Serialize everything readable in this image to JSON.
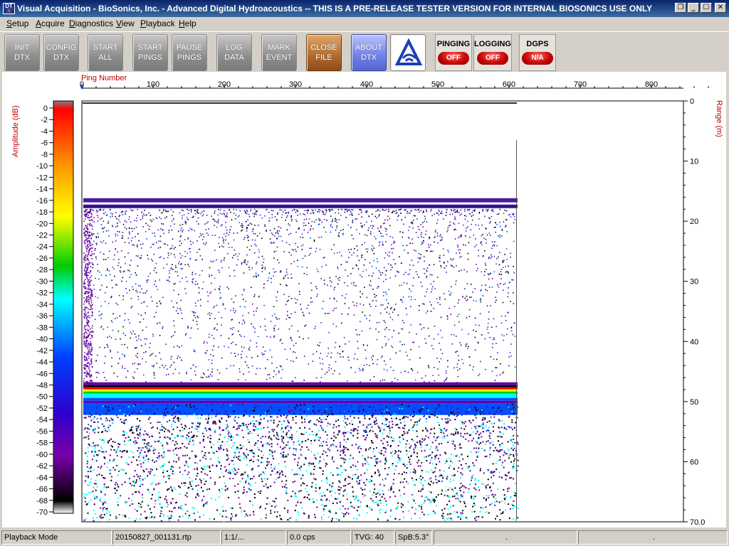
{
  "window": {
    "title": "Visual Acquisition  -  BioSonics, Inc.  -  Advanced Digital Hydroacoustics  -- THIS IS A PRE-RELEASE TESTER VERSION FOR INTERNAL BIOSONICS USE ONLY",
    "icon_top": "DT",
    "icon_bottom": "X",
    "restore_glyph": "❐",
    "minimize_glyph": "_",
    "maximize_glyph": "☐",
    "close_glyph": "✕"
  },
  "menu": {
    "items": [
      {
        "accel": "S",
        "rest": "etup"
      },
      {
        "accel": "A",
        "rest": "cquire"
      },
      {
        "accel": "D",
        "rest": "iagnostics"
      },
      {
        "accel": "V",
        "rest": "iew"
      },
      {
        "accel": "P",
        "rest": "layback"
      },
      {
        "accel": "H",
        "rest": "elp"
      }
    ]
  },
  "toolbar": {
    "init": "INIT\nDTX",
    "config": "CONFIG\nDTX",
    "start_all": "START\nALL",
    "start_pings": "START\nPINGS",
    "pause_pings": "PAUSE\nPINGS",
    "log_data": "LOG\nDATA",
    "mark_event": "MARK\nEVENT",
    "close_file": "CLOSE\nFILE",
    "about": "ABOUT\nDTX",
    "logo_icon": "biosonics-logo-icon",
    "pinging_label": "PINGING",
    "pinging_state": "OFF",
    "logging_label": "LOGGING",
    "logging_state": "OFF",
    "dgps_label": "DGPS",
    "dgps_state": "N/A"
  },
  "plot": {
    "ping_label": "Ping Number",
    "amp_label": "Amplitude (dB)",
    "range_label": "Range (m)",
    "ping_ticks": [
      "0",
      "100",
      "200",
      "300",
      "400",
      "500",
      "600",
      "700",
      "800"
    ],
    "range_ticks": [
      "0",
      "10",
      "20",
      "30",
      "40",
      "50",
      "60",
      "70.0"
    ],
    "amp_ticks": [
      "0",
      "-2",
      "-4",
      "-6",
      "-8",
      "-10",
      "-12",
      "-14",
      "-16",
      "-18",
      "-20",
      "-22",
      "-24",
      "-26",
      "-28",
      "-30",
      "-32",
      "-34",
      "-36",
      "-38",
      "-40",
      "-42",
      "-44",
      "-46",
      "-48",
      "-50",
      "-52",
      "-54",
      "-56",
      "-58",
      "-60",
      "-62",
      "-64",
      "-66",
      "-68",
      "-70"
    ],
    "current_ping": 0,
    "max_ping": 610,
    "surface_depth_m": 17,
    "bottom_depth_m": 47.5,
    "colors": {
      "red": "#ff0000",
      "orange": "#ff9900",
      "yellow": "#ffff00",
      "green": "#00cc00",
      "cyan": "#00ffff",
      "blue": "#0050ff",
      "purple": "#6600aa",
      "black": "#000000"
    }
  },
  "statusbar": {
    "mode": "Playback Mode",
    "file": "20150827_001131.rtp",
    "ratio": "1:1/...",
    "cps": "0.0 cps",
    "tvg": "TVG: 40",
    "spb": "SpB:5.3°",
    "blank1": ".",
    "blank2": "."
  }
}
